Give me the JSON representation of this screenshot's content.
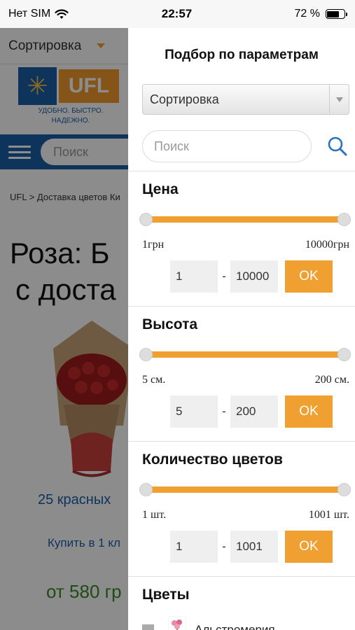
{
  "status_bar": {
    "carrier": "Нет SIM",
    "time": "22:57",
    "battery_text": "72 %",
    "battery_level": 0.72
  },
  "background_page": {
    "sort_label": "Сортировка",
    "logo_text": "UFL",
    "logo_tagline": "УДОБНО. БЫСТРО. НАДЕЖНО.",
    "search_placeholder": "Поиск",
    "breadcrumb": "UFL > Доставка цветов Ки",
    "title_line1": "Роза: Б",
    "title_line2": "с доста",
    "product_name": "25 красных",
    "buy_link": "Купить в 1 кл",
    "price": "от 580 гр"
  },
  "filter_panel": {
    "title": "Подбор по параметрам",
    "sort_select": "Сортировка",
    "search_placeholder": "Поиск",
    "price": {
      "label": "Цена",
      "min_label": "1грн",
      "max_label": "10000грн",
      "from": "1",
      "to": "10000",
      "ok": "OK"
    },
    "height": {
      "label": "Высота",
      "min_label": "5 см.",
      "max_label": "200 см.",
      "from": "5",
      "to": "200",
      "ok": "OK"
    },
    "count": {
      "label": "Количество цветов",
      "min_label": "1 шт.",
      "max_label": "1001 шт.",
      "from": "1",
      "to": "1001",
      "ok": "OK"
    },
    "flowers": {
      "label": "Цветы",
      "items": [
        {
          "name": "Альстромерия"
        }
      ]
    }
  },
  "colors": {
    "accent": "#f0a030",
    "brand_blue": "#1b5fa8",
    "price_green": "#3a8b26"
  }
}
